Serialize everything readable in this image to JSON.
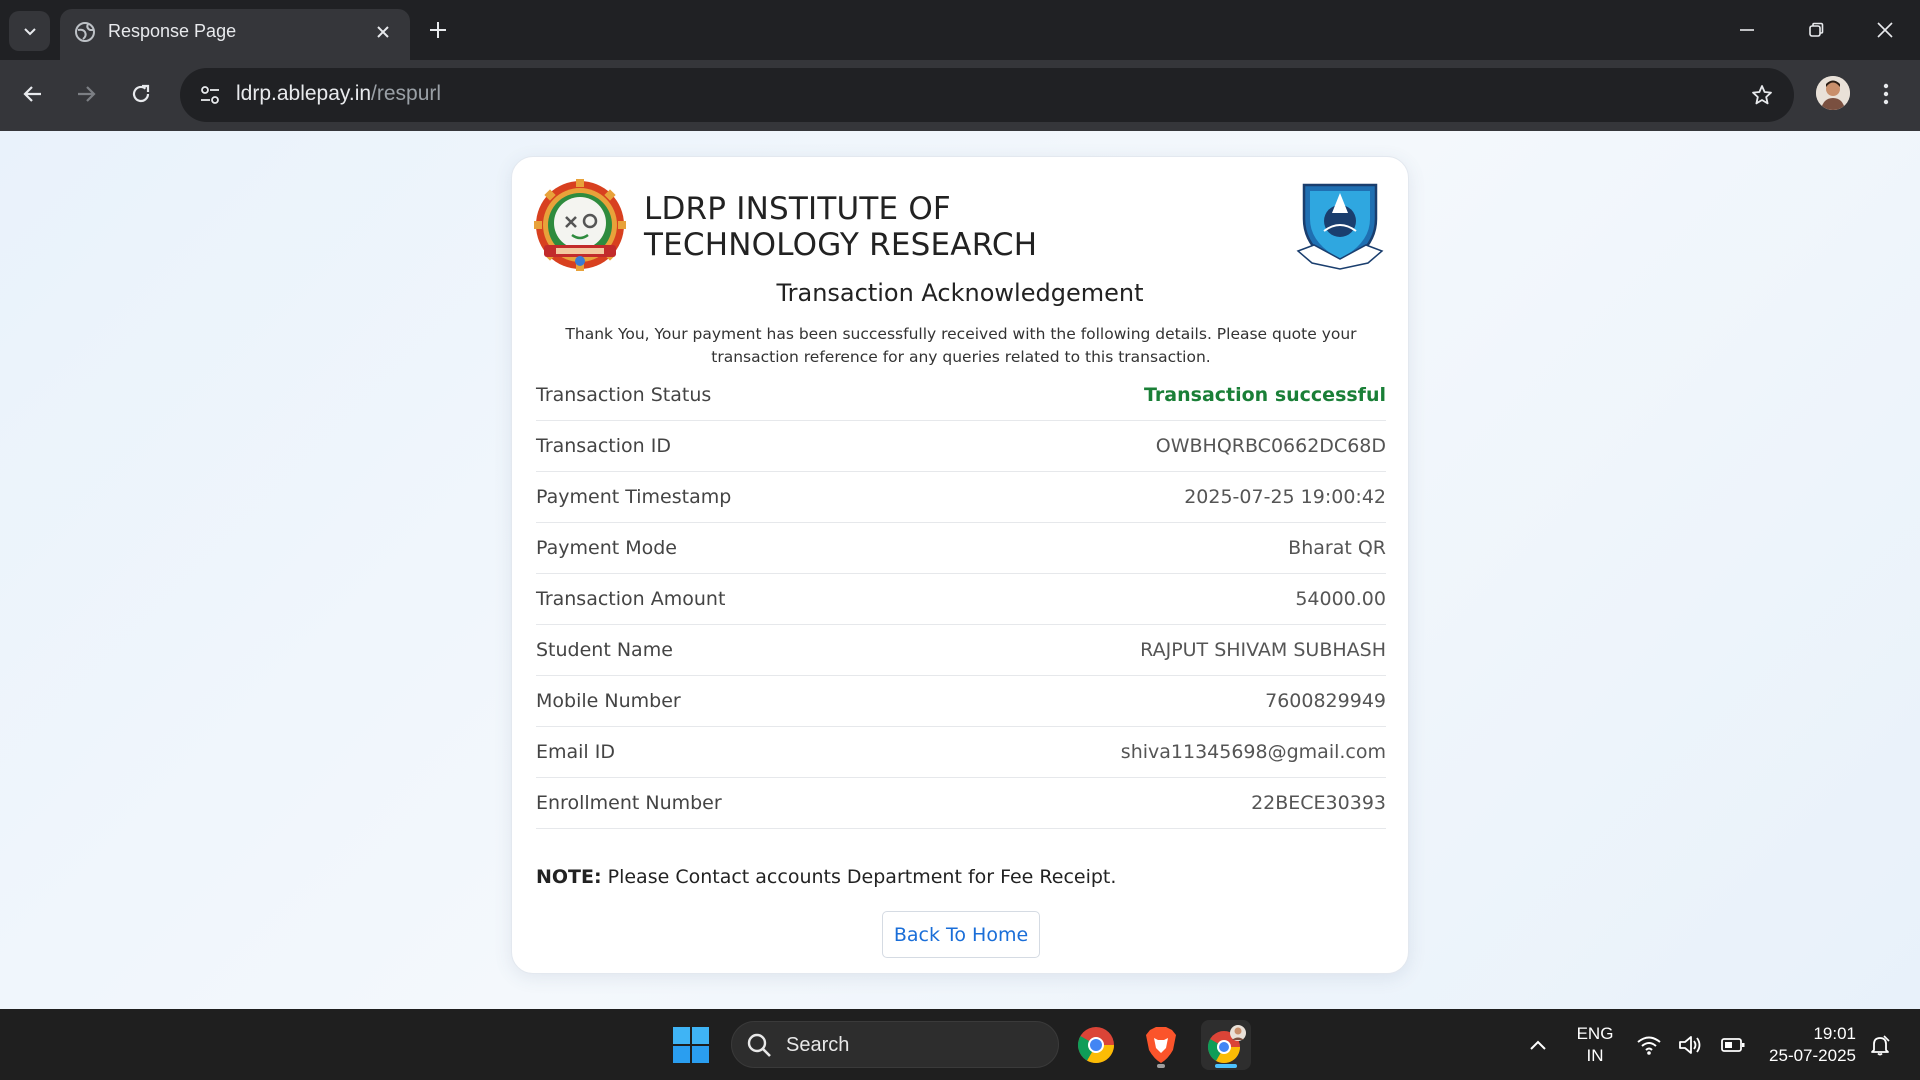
{
  "browser": {
    "tab_title": "Response Page",
    "url_host": "ldrp.ablepay.in",
    "url_path": "/respurl"
  },
  "page": {
    "institute_name": "LDRP INSTITUTE OF TECHNOLOGY RESEARCH",
    "heading": "Transaction Acknowledgement",
    "description": "Thank You, Your payment has been successfully received with the following details. Please quote your transaction reference for any queries related to this transaction.",
    "details": [
      {
        "label": "Transaction Status",
        "value": "Transaction successful"
      },
      {
        "label": "Transaction ID",
        "value": "OWBHQRBC0662DC68D"
      },
      {
        "label": "Payment Timestamp",
        "value": "2025-07-25 19:00:42"
      },
      {
        "label": "Payment Mode",
        "value": "Bharat QR"
      },
      {
        "label": "Transaction Amount",
        "value": "54000.00"
      },
      {
        "label": "Student Name",
        "value": "RAJPUT SHIVAM SUBHASH"
      },
      {
        "label": "Mobile Number",
        "value": "7600829949"
      },
      {
        "label": "Email ID",
        "value": "shiva11345698@gmail.com"
      },
      {
        "label": "Enrollment Number",
        "value": "22BECE30393"
      }
    ],
    "note_label": "NOTE:",
    "note_text": " Please Contact accounts Department for Fee Receipt.",
    "back_button": "Back To Home",
    "success_color": "#1a7f37",
    "link_color": "#1a6ed8"
  },
  "taskbar": {
    "search_label": "Search",
    "lang_line1": "ENG",
    "lang_line2": "IN",
    "time": "19:01",
    "date": "25-07-2025"
  }
}
